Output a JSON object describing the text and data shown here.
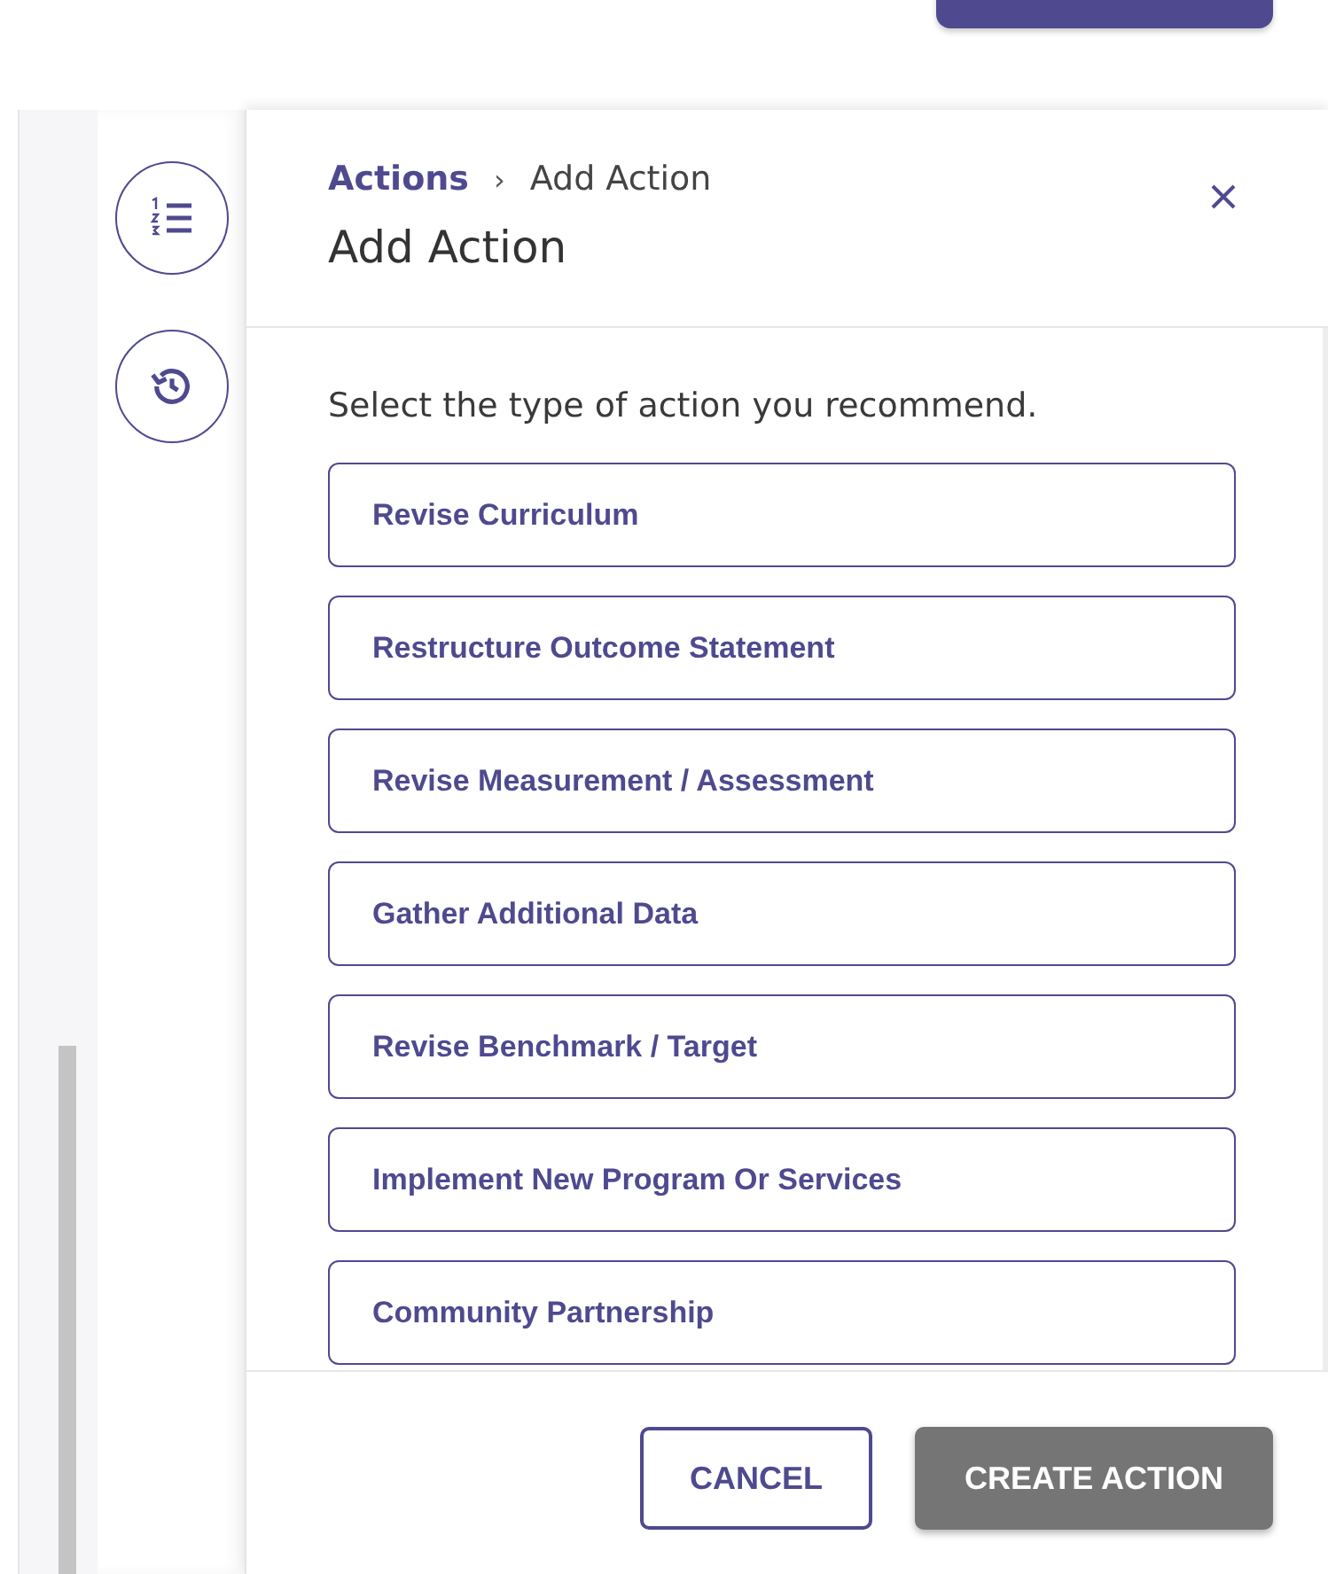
{
  "breadcrumb": {
    "parent": "Actions",
    "separator": "›",
    "current": "Add Action"
  },
  "title": "Add Action",
  "prompt": "Select the type of action you recommend.",
  "options": [
    {
      "label": "Revise Curriculum",
      "selected": false
    },
    {
      "label": "Restructure Outcome Statement",
      "selected": false
    },
    {
      "label": "Revise Measurement / Assessment",
      "selected": false
    },
    {
      "label": "Gather Additional Data",
      "selected": false
    },
    {
      "label": "Revise Benchmark / Target",
      "selected": false
    },
    {
      "label": "Implement New Program Or Services",
      "selected": false
    },
    {
      "label": "Community Partnership",
      "selected": false
    }
  ],
  "buttons": [
    {
      "label": "CANCEL",
      "kind": "secondary",
      "disabled": false
    },
    {
      "label": "CREATE ACTION",
      "kind": "primary",
      "disabled": true
    }
  ]
}
